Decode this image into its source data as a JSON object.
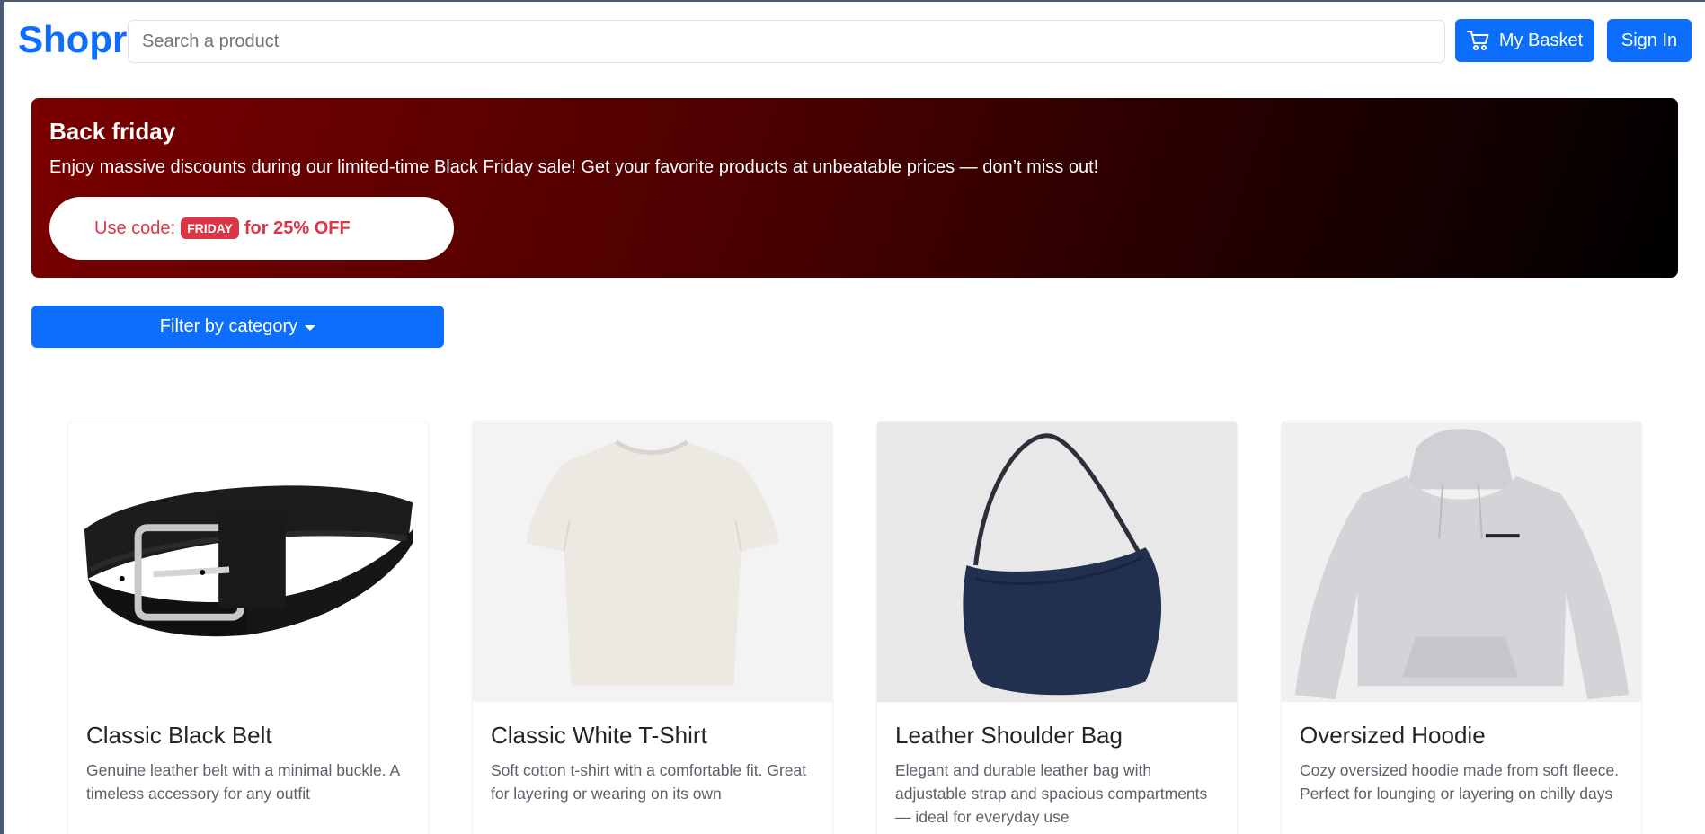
{
  "navbar": {
    "brand": "Shopr",
    "search_placeholder": "Search a product",
    "basket_label": "My Basket",
    "signin_label": "Sign In"
  },
  "banner": {
    "title": "Back friday",
    "text": "Enjoy massive discounts during our limited-time Black Friday sale! Get your favorite products at unbeatable prices — don’t miss out!",
    "promo_prefix": "Use code:",
    "promo_code": "FRIDAY",
    "promo_suffix": "for 25% OFF"
  },
  "filter": {
    "label": "Filter by category"
  },
  "products": [
    {
      "title": "Classic Black Belt",
      "description": "Genuine leather belt with a minimal buckle. A timeless accessory for any outfit",
      "image": "belt"
    },
    {
      "title": "Classic White T-Shirt",
      "description": "Soft cotton t-shirt with a comfortable fit. Great for layering or wearing on its own",
      "image": "tshirt"
    },
    {
      "title": "Leather Shoulder Bag",
      "description": "Elegant and durable leather bag with adjustable strap and spacious compartments — ideal for everyday use",
      "image": "bag"
    },
    {
      "title": "Oversized Hoodie",
      "description": "Cozy oversized hoodie made from soft fleece. Perfect for lounging or layering on chilly days",
      "image": "hoodie"
    }
  ],
  "colors": {
    "primary": "#0d6efd",
    "danger": "#dc3545",
    "banner_start": "#7a0000",
    "banner_end": "#000000"
  }
}
